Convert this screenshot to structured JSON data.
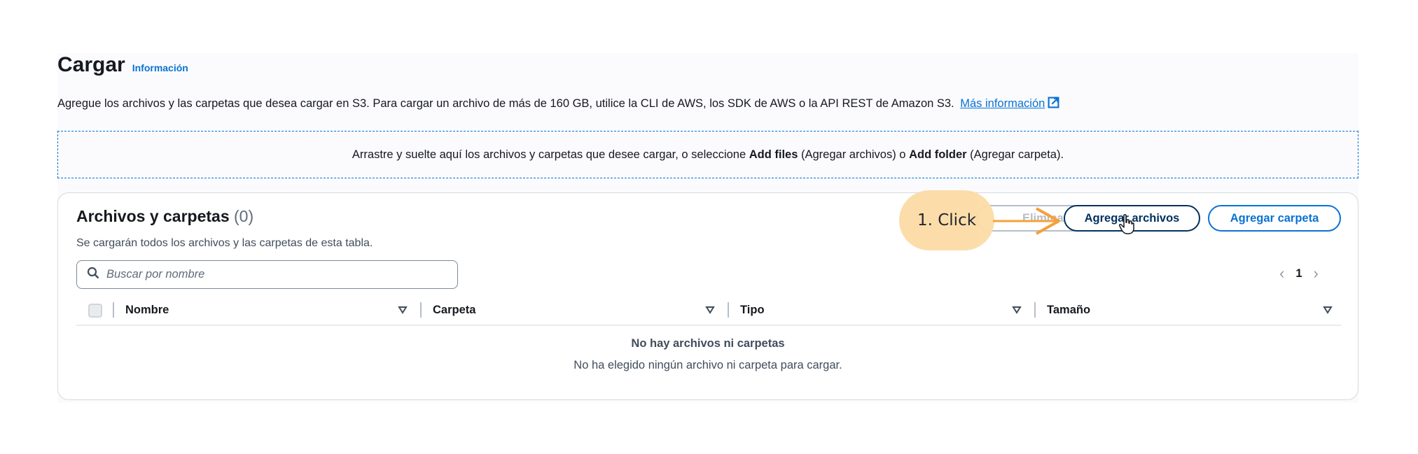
{
  "header": {
    "title": "Cargar",
    "info_link": "Información"
  },
  "description": {
    "text": "Agregue los archivos y las carpetas que desea cargar en S3. Para cargar un archivo de más de 160 GB, utilice la CLI de AWS, los SDK de AWS o la API REST de Amazon S3.",
    "more_link": "Más información"
  },
  "dropzone": {
    "part1": "Arrastre y suelte aquí los archivos y carpetas que desee cargar, o seleccione ",
    "add_files": "Add files",
    "part2": " (Agregar archivos) o ",
    "add_folder": "Add folder",
    "part3": " (Agregar carpeta)."
  },
  "files_panel": {
    "title": "Archivos y carpetas",
    "count": "(0)",
    "subtitle": "Se cargarán todos los archivos y las carpetas de esta tabla.",
    "buttons": {
      "delete": "Eliminar",
      "add_files": "Agregar archivos",
      "add_folder": "Agregar carpeta"
    },
    "search": {
      "placeholder": "Buscar por nombre"
    },
    "pagination": {
      "current_page": "1"
    },
    "columns": [
      "Nombre",
      "Carpeta",
      "Tipo",
      "Tamaño"
    ],
    "empty": {
      "title": "No hay archivos ni carpetas",
      "subtitle": "No ha elegido ningún archivo ni carpeta para cargar."
    }
  },
  "annotation": {
    "label": "1. Click",
    "color": "#fcdca6",
    "arrow_color": "#f5a03a"
  },
  "colors": {
    "link": "#0972d3",
    "primary_dark": "#033160",
    "disabled": "#b6bec9"
  }
}
